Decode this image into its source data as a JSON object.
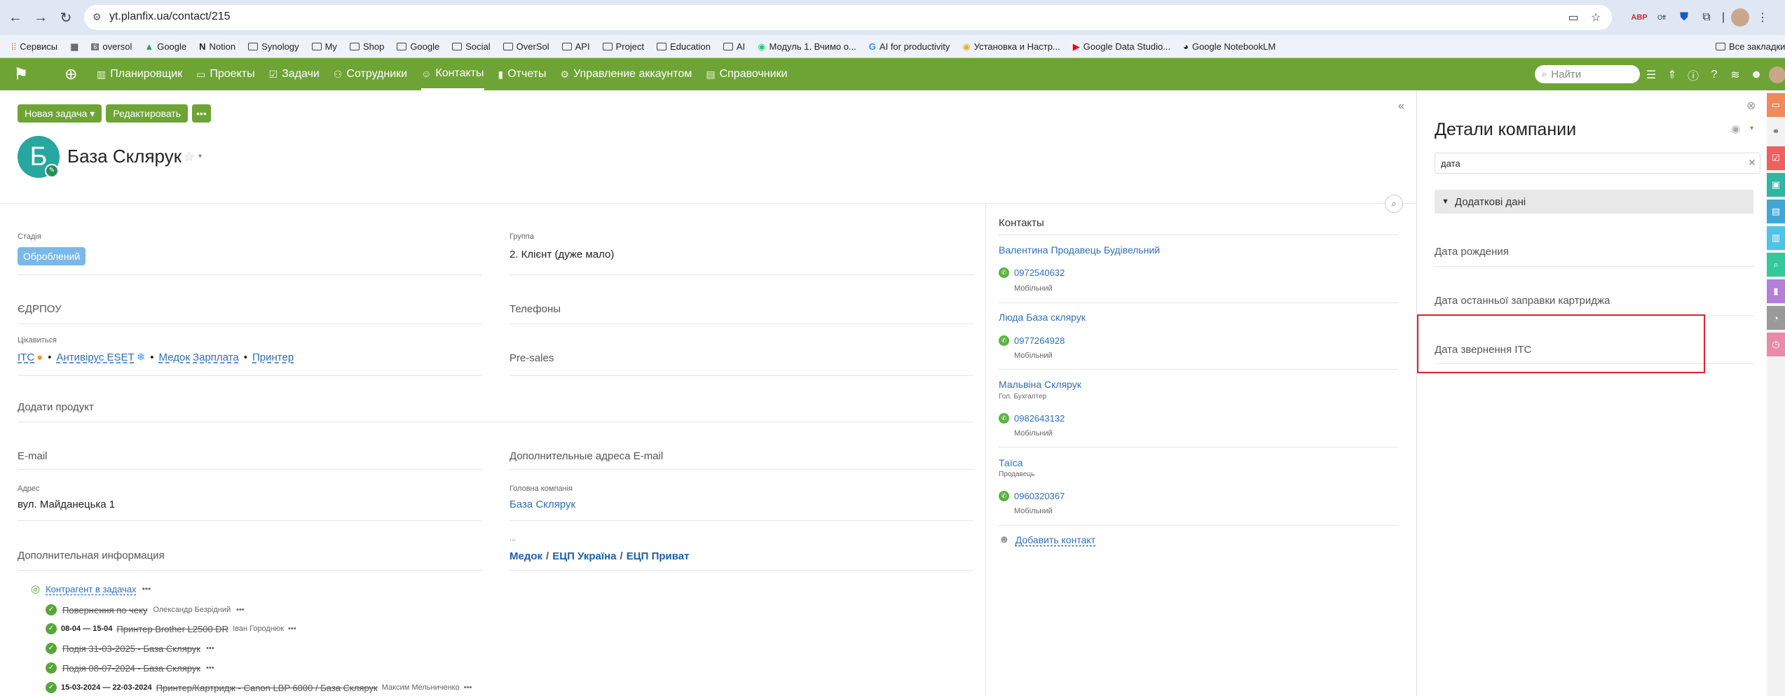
{
  "browser": {
    "url": "yt.planfix.ua/contact/215",
    "bookmarks": [
      {
        "label": "Сервисы",
        "icon": "grid-icon"
      },
      {
        "label": "",
        "icon": "apps-icon"
      },
      {
        "label": "oversol",
        "icon": "site-icon"
      },
      {
        "label": "Google",
        "icon": "drive-icon"
      },
      {
        "label": "Notion",
        "icon": "notion-icon"
      },
      {
        "label": "Synology",
        "icon": "folder-icon"
      },
      {
        "label": "My",
        "icon": "folder-icon"
      },
      {
        "label": "Shop",
        "icon": "folder-icon"
      },
      {
        "label": "Google",
        "icon": "folder-icon"
      },
      {
        "label": "Social",
        "icon": "folder-icon"
      },
      {
        "label": "OverSol",
        "icon": "folder-icon"
      },
      {
        "label": "API",
        "icon": "folder-icon"
      },
      {
        "label": "Project",
        "icon": "folder-icon"
      },
      {
        "label": "Education",
        "icon": "folder-icon"
      },
      {
        "label": "AI",
        "icon": "folder-icon"
      },
      {
        "label": "Модуль 1. Вчимо о...",
        "icon": "site-icon"
      },
      {
        "label": "AI for productivity",
        "icon": "google-icon"
      },
      {
        "label": "Установка и Настр...",
        "icon": "site-icon"
      },
      {
        "label": "Google Data Studio...",
        "icon": "youtube-icon"
      },
      {
        "label": "Google NotebookLM",
        "icon": "notebook-icon"
      }
    ],
    "all_bookmarks": "Все закладки",
    "off_badge": "Off"
  },
  "nav": {
    "items": [
      {
        "label": "Планировщик",
        "icon": "planner-icon"
      },
      {
        "label": "Проекты",
        "icon": "folder-icon"
      },
      {
        "label": "Задачи",
        "icon": "task-icon"
      },
      {
        "label": "Сотрудники",
        "icon": "people-icon"
      },
      {
        "label": "Контакты",
        "icon": "contact-icon"
      },
      {
        "label": "Отчеты",
        "icon": "chart-icon"
      },
      {
        "label": "Управление аккаунтом",
        "icon": "gear-icon"
      },
      {
        "label": "Справочники",
        "icon": "book-icon"
      }
    ],
    "search_placeholder": "Найти"
  },
  "toolbar": {
    "new_task": "Новая задача ▾",
    "edit": "Редактировать",
    "more": "•••"
  },
  "contact": {
    "avatar_letter": "Б",
    "name": "База Склярук"
  },
  "fields": {
    "stage_label": "Стадія",
    "stage_value": "Оброблений",
    "group_label": "Группа",
    "group_value": "2. Клієнт (дуже мало)",
    "edrpou": "ЄДРПОУ",
    "phones": "Телефоны",
    "interest_label": "Цікавиться",
    "interests": [
      "ІТС",
      "Антивірус ESET",
      "Медок Зарплата",
      "Принтер"
    ],
    "presales": "Pre-sales",
    "add_product": "Додати продукт",
    "email": "E-mail",
    "extra_email": "Дополнительные адреса E-mail",
    "address_label": "Адрес",
    "address_value": "вул. Майданецька 1",
    "head_company_label": "Головна компанія",
    "head_company_value": "База Склярук",
    "dots": "...",
    "products": [
      "Медок",
      "ЕЦП Україна",
      "ЕЦП Приват"
    ],
    "extra_info": "Дополнительная информация"
  },
  "tasks": {
    "header": "Контрагент в задачах",
    "items": [
      {
        "date": "",
        "title": "Повернення по чеку",
        "person": "Олександр Безрідний"
      },
      {
        "date": "08-04 — 15-04",
        "title": "Принтер Brother L2500 DR",
        "person": "Іван Городнюк"
      },
      {
        "date": "",
        "title": "Подія 31-03-2025 - База Склярук",
        "person": ""
      },
      {
        "date": "",
        "title": "Подія 08-07-2024 - База Склярук",
        "person": ""
      },
      {
        "date": "15-03-2024 — 22-03-2024",
        "title": "Принтер/Картридж - Canon LBP 6000 / База Склярук",
        "person": "Максим Мельниченко"
      }
    ]
  },
  "contacts": {
    "title": "Контакты",
    "people": [
      {
        "name": "Валентина Продавець Будівельний",
        "role": "",
        "phone": "0972540632",
        "type": "Мобільний"
      },
      {
        "name": "Люда База склярук",
        "role": "",
        "phone": "0977264928",
        "type": "Мобільний"
      },
      {
        "name": "Мальвіна Склярук",
        "role": "Гол. Бухгалтер",
        "phone": "0982643132",
        "type": "Мобільний"
      },
      {
        "name": "Таїса",
        "role": "Продавець",
        "phone": "0960320367",
        "type": "Мобільний"
      }
    ],
    "add": "Добавить контакт"
  },
  "panel": {
    "title": "Детали компании",
    "search_value": "дата",
    "section": "Додаткові дані",
    "fields": [
      "Дата рождения",
      "Дата останньої заправки картриджа",
      "Дата звернення ІТС"
    ]
  },
  "colors": {
    "nav_green": "#6ea435",
    "link_blue": "#2d6fb8",
    "highlight_red": "#d9232e",
    "tag_blue": "#7ab8e8"
  }
}
